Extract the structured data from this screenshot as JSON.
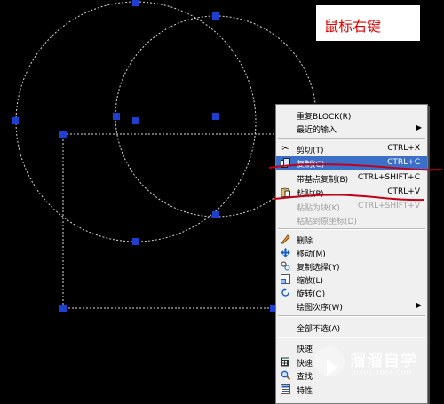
{
  "annotation": {
    "text": "鼠标右键",
    "color": "#e00000"
  },
  "context_menu": {
    "items": [
      {
        "label": "重复BLOCK(R)",
        "shortcut": "",
        "icon": "",
        "submenu": false,
        "disabled": false
      },
      {
        "label": "最近的输入",
        "shortcut": "",
        "icon": "",
        "submenu": true,
        "disabled": false
      },
      {
        "label": "剪切(T)",
        "shortcut": "CTRL+X",
        "icon": "scissors-icon",
        "submenu": false,
        "disabled": false
      },
      {
        "label": "复制(C)",
        "shortcut": "CTRL+C",
        "icon": "copy-icon",
        "submenu": false,
        "disabled": false,
        "highlighted": true
      },
      {
        "label": "带基点复制(B)",
        "shortcut": "CTRL+SHIFT+C",
        "icon": "",
        "submenu": false,
        "disabled": false
      },
      {
        "label": "粘贴(P)",
        "shortcut": "CTRL+V",
        "icon": "paste-icon",
        "submenu": false,
        "disabled": false
      },
      {
        "label": "粘贴为块(K)",
        "shortcut": "CTRL+SHIFT+V",
        "icon": "",
        "submenu": false,
        "disabled": true
      },
      {
        "label": "粘贴到原坐标(D)",
        "shortcut": "",
        "icon": "",
        "submenu": false,
        "disabled": true
      },
      {
        "label": "删除",
        "shortcut": "",
        "icon": "eraser-icon",
        "submenu": false,
        "disabled": false
      },
      {
        "label": "移动(M)",
        "shortcut": "",
        "icon": "move-icon",
        "submenu": false,
        "disabled": false
      },
      {
        "label": "复制选择(Y)",
        "shortcut": "",
        "icon": "copy-selection-icon",
        "submenu": false,
        "disabled": false
      },
      {
        "label": "缩放(L)",
        "shortcut": "",
        "icon": "scale-icon",
        "submenu": false,
        "disabled": false
      },
      {
        "label": "旋转(O)",
        "shortcut": "",
        "icon": "rotate-icon",
        "submenu": false,
        "disabled": false
      },
      {
        "label": "绘图次序(W)",
        "shortcut": "",
        "icon": "",
        "submenu": true,
        "disabled": false
      },
      {
        "label": "全部不选(A)",
        "shortcut": "",
        "icon": "",
        "submenu": false,
        "disabled": false
      },
      {
        "label": "快速",
        "shortcut": "",
        "icon": "",
        "submenu": false,
        "disabled": false
      },
      {
        "label": "快速",
        "shortcut": "",
        "icon": "calculator-icon",
        "submenu": false,
        "disabled": false
      },
      {
        "label": "查找",
        "shortcut": "",
        "icon": "find-icon",
        "submenu": false,
        "disabled": false
      },
      {
        "label": "特性",
        "shortcut": "",
        "icon": "properties-icon",
        "submenu": false,
        "disabled": false
      }
    ]
  },
  "watermark": {
    "title": "溜溜自学",
    "url": "ZIXUE.3D66.COM"
  },
  "colors": {
    "grip": "#1e3fd0",
    "dashed_line": "#ffffff",
    "highlight": "#3c6fc8",
    "mark_line": "#c0001a"
  }
}
